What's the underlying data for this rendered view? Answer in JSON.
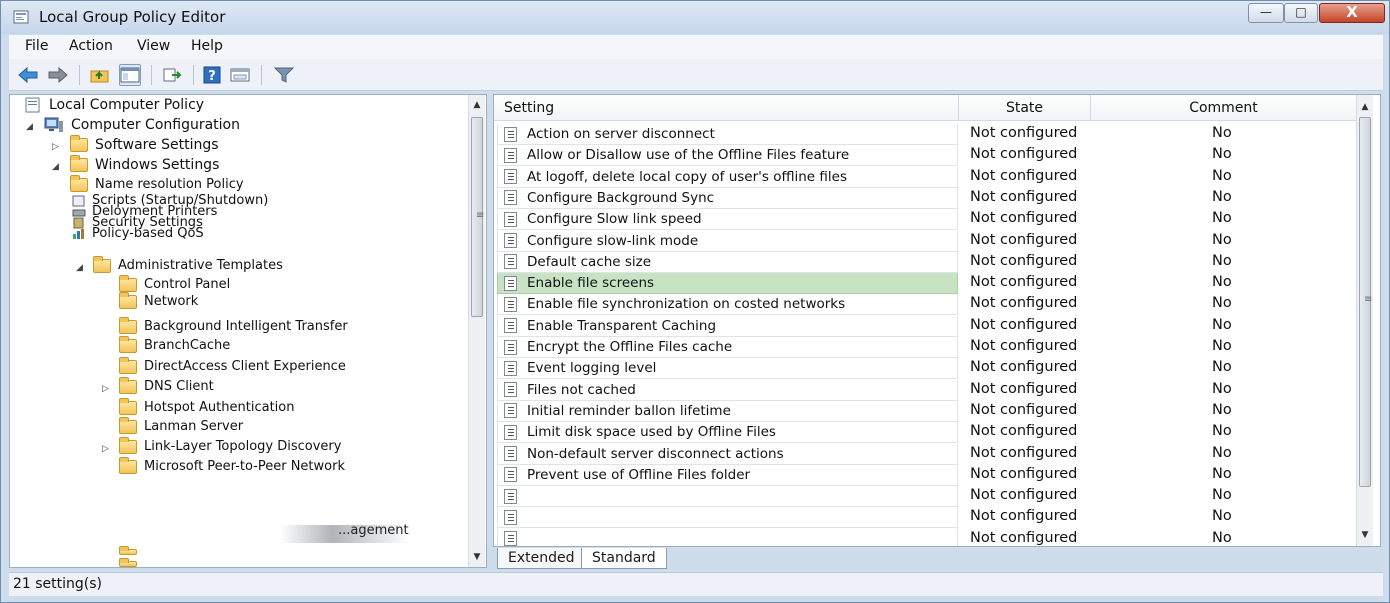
{
  "window": {
    "title": "Local Group Policy Editor",
    "controls": {
      "minimize": "—",
      "maximize": "□",
      "close": "X"
    }
  },
  "menu": [
    "File",
    "Action",
    "View",
    "Help"
  ],
  "toolbar": [
    "back-icon",
    "forward-icon",
    "up-folder-icon",
    "show-hide-tree-icon",
    "export-list-icon",
    "help-icon",
    "properties-icon",
    "filter-icon"
  ],
  "tree": {
    "root": "Local Computer Policy",
    "computer_configuration": "Computer Configuration",
    "software_settings": "Software Settings",
    "windows_settings": "Windows Settings",
    "windows_children": [
      "Name resolution Policy",
      "Scripts (Startup/Shutdown)",
      "Deloyment Printers",
      "Security Settings",
      "Policy-based QoS"
    ],
    "administrative_templates": "Administrative Templates",
    "admin_children": [
      "Control Panel",
      "Network",
      "Background Intelligent Transfer",
      "BranchCache",
      "DirectAccess Client Experience",
      "DNS Client",
      "Hotspot Authentication",
      "Lanman Server",
      "Link-Layer Topology Discovery",
      "Microsoft Peer-to-Peer Network"
    ],
    "partial_label": "...agement"
  },
  "list": {
    "columns": {
      "setting": "Setting",
      "state": "State",
      "comment": "Comment"
    },
    "rows": [
      {
        "name": "Action on server disconnect",
        "state": "Not configured",
        "comment": "No"
      },
      {
        "name": "Allow or Disallow use of the Offline Files feature",
        "state": "Not configured",
        "comment": "No"
      },
      {
        "name": "At logoff, delete local copy of user's offline files",
        "state": "Not configured",
        "comment": "No"
      },
      {
        "name": "Configure Background Sync",
        "state": "Not configured",
        "comment": "No"
      },
      {
        "name": "Configure Slow link speed",
        "state": "Not configured",
        "comment": "No"
      },
      {
        "name": "Configure slow-link mode",
        "state": "Not configured",
        "comment": "No"
      },
      {
        "name": "Default cache size",
        "state": "Not configured",
        "comment": "No"
      },
      {
        "name": "Enable file screens",
        "state": "Not configured",
        "comment": "No"
      },
      {
        "name": "Enable file synchronization on costed networks",
        "state": "Not configured",
        "comment": "No"
      },
      {
        "name": "Enable Transparent Caching",
        "state": "Not configured",
        "comment": "No"
      },
      {
        "name": "Encrypt the Offline Files cache",
        "state": "Not configured",
        "comment": "No"
      },
      {
        "name": "Event logging level",
        "state": "Not configured",
        "comment": "No"
      },
      {
        "name": "Files not cached",
        "state": "Not configured",
        "comment": "No"
      },
      {
        "name": "Initial reminder ballon lifetime",
        "state": "Not configured",
        "comment": "No"
      },
      {
        "name": "Limit disk space used by Offline Files",
        "state": "Not configured",
        "comment": "No"
      },
      {
        "name": "Non-default server disconnect actions",
        "state": "Not configured",
        "comment": "No"
      },
      {
        "name": "Prevent use of Offline Files folder",
        "state": "Not configured",
        "comment": "No"
      },
      {
        "name": "",
        "state": "Not configured",
        "comment": "No"
      },
      {
        "name": "",
        "state": "Not configured",
        "comment": "No"
      },
      {
        "name": "",
        "state": "Not configured",
        "comment": "No"
      }
    ],
    "selected_index": 7
  },
  "tabs": [
    "Extended",
    "Standard"
  ],
  "status": "21 setting(s)",
  "colors": {
    "selected_row": "#c8e3c4",
    "title_bar": "#c6d6ea",
    "close_button": "#c2452a"
  }
}
